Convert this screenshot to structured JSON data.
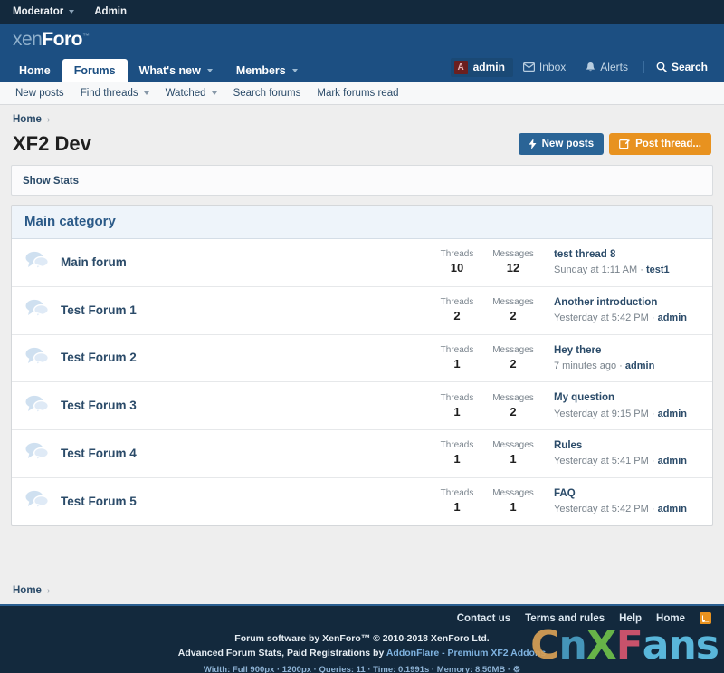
{
  "top_bar": {
    "items": [
      {
        "label": "Moderator",
        "has_caret": true,
        "icon": "chevron-down-icon"
      },
      {
        "label": "Admin",
        "has_caret": false,
        "icon": null
      }
    ]
  },
  "header": {
    "logo_part1": "xen",
    "logo_part2": "Foro",
    "logo_tm": "™"
  },
  "nav": {
    "items": [
      {
        "label": "Home",
        "active": false,
        "has_caret": false
      },
      {
        "label": "Forums",
        "active": true,
        "has_caret": false
      },
      {
        "label": "What's new",
        "active": false,
        "has_caret": true
      },
      {
        "label": "Members",
        "active": false,
        "has_caret": true
      }
    ],
    "user": {
      "avatar_initial": "A",
      "name": "admin",
      "avatar_color": "#6b1f1f"
    },
    "inbox": {
      "label": "Inbox",
      "icon": "envelope-icon"
    },
    "alerts": {
      "label": "Alerts",
      "icon": "bell-icon"
    },
    "search": {
      "label": "Search",
      "icon": "search-icon"
    }
  },
  "subnav": {
    "items": [
      {
        "label": "New posts",
        "has_caret": false
      },
      {
        "label": "Find threads",
        "has_caret": true
      },
      {
        "label": "Watched",
        "has_caret": true
      },
      {
        "label": "Search forums",
        "has_caret": false
      },
      {
        "label": "Mark forums read",
        "has_caret": false
      }
    ]
  },
  "breadcrumb": {
    "home": "Home",
    "separator": "›"
  },
  "page": {
    "title": "XF2 Dev",
    "new_posts_button": "New posts",
    "new_posts_icon": "lightning-bolt-icon",
    "post_thread_button": "Post thread...",
    "post_thread_icon": "write-pencil-icon",
    "show_stats": "Show Stats"
  },
  "forum_block": {
    "category_title": "Main category",
    "threads_label": "Threads",
    "messages_label": "Messages",
    "meta_separator": "·",
    "forums": [
      {
        "name": "Main forum",
        "icon": "speech-bubbles-icon",
        "threads": "10",
        "messages": "12",
        "last_title": "test thread 8",
        "last_time": "Sunday at 1:11 AM",
        "last_user": "test1"
      },
      {
        "name": "Test Forum 1",
        "icon": "speech-bubbles-icon",
        "threads": "2",
        "messages": "2",
        "last_title": "Another introduction",
        "last_time": "Yesterday at 5:42 PM",
        "last_user": "admin"
      },
      {
        "name": "Test Forum 2",
        "icon": "speech-bubbles-icon",
        "threads": "1",
        "messages": "2",
        "last_title": "Hey there",
        "last_time": "7 minutes ago",
        "last_user": "admin"
      },
      {
        "name": "Test Forum 3",
        "icon": "speech-bubbles-icon",
        "threads": "1",
        "messages": "2",
        "last_title": "My question",
        "last_time": "Yesterday at 9:15 PM",
        "last_user": "admin"
      },
      {
        "name": "Test Forum 4",
        "icon": "speech-bubbles-icon",
        "threads": "1",
        "messages": "1",
        "last_title": "Rules",
        "last_time": "Yesterday at 5:41 PM",
        "last_user": "admin"
      },
      {
        "name": "Test Forum 5",
        "icon": "speech-bubbles-icon",
        "threads": "1",
        "messages": "1",
        "last_title": "FAQ",
        "last_time": "Yesterday at 5:42 PM",
        "last_user": "admin"
      }
    ]
  },
  "footer": {
    "breadcrumb_home": "Home",
    "breadcrumb_separator": "›",
    "links": [
      {
        "label": "Contact us"
      },
      {
        "label": "Terms and rules"
      },
      {
        "label": "Help"
      },
      {
        "label": "Home"
      }
    ],
    "rss_icon": "rss-icon",
    "copyright_line1": "Forum software by XenForo™ © 2010-2018 XenForo Ltd.",
    "credit_prefix": "Advanced Forum Stats, Paid Registrations by ",
    "credit_link": "AddonFlare - Premium XF2 Addons",
    "debug_line": "Width: Full 900px · 1200px · Queries: 11 · Time: 0.1991s · Memory: 8.50MB · ⚙"
  },
  "watermark": {
    "letters": [
      {
        "char": "C",
        "color": "#d8a055"
      },
      {
        "char": "n",
        "color": "#4a9fc4"
      },
      {
        "char": "X",
        "color": "#6fbf4a"
      },
      {
        "char": "F",
        "color": "#d8566f"
      },
      {
        "char": "a",
        "color": "#5fc3e8"
      },
      {
        "char": "n",
        "color": "#5fc3e8"
      },
      {
        "char": "s",
        "color": "#5fc3e8"
      }
    ]
  },
  "colors": {
    "top_bar": "#13293d",
    "header": "#1c4f82",
    "accent_blue": "#2a6496",
    "accent_orange": "#e8921f",
    "page_bg": "#eeeeee",
    "link": "#2b4b69"
  }
}
